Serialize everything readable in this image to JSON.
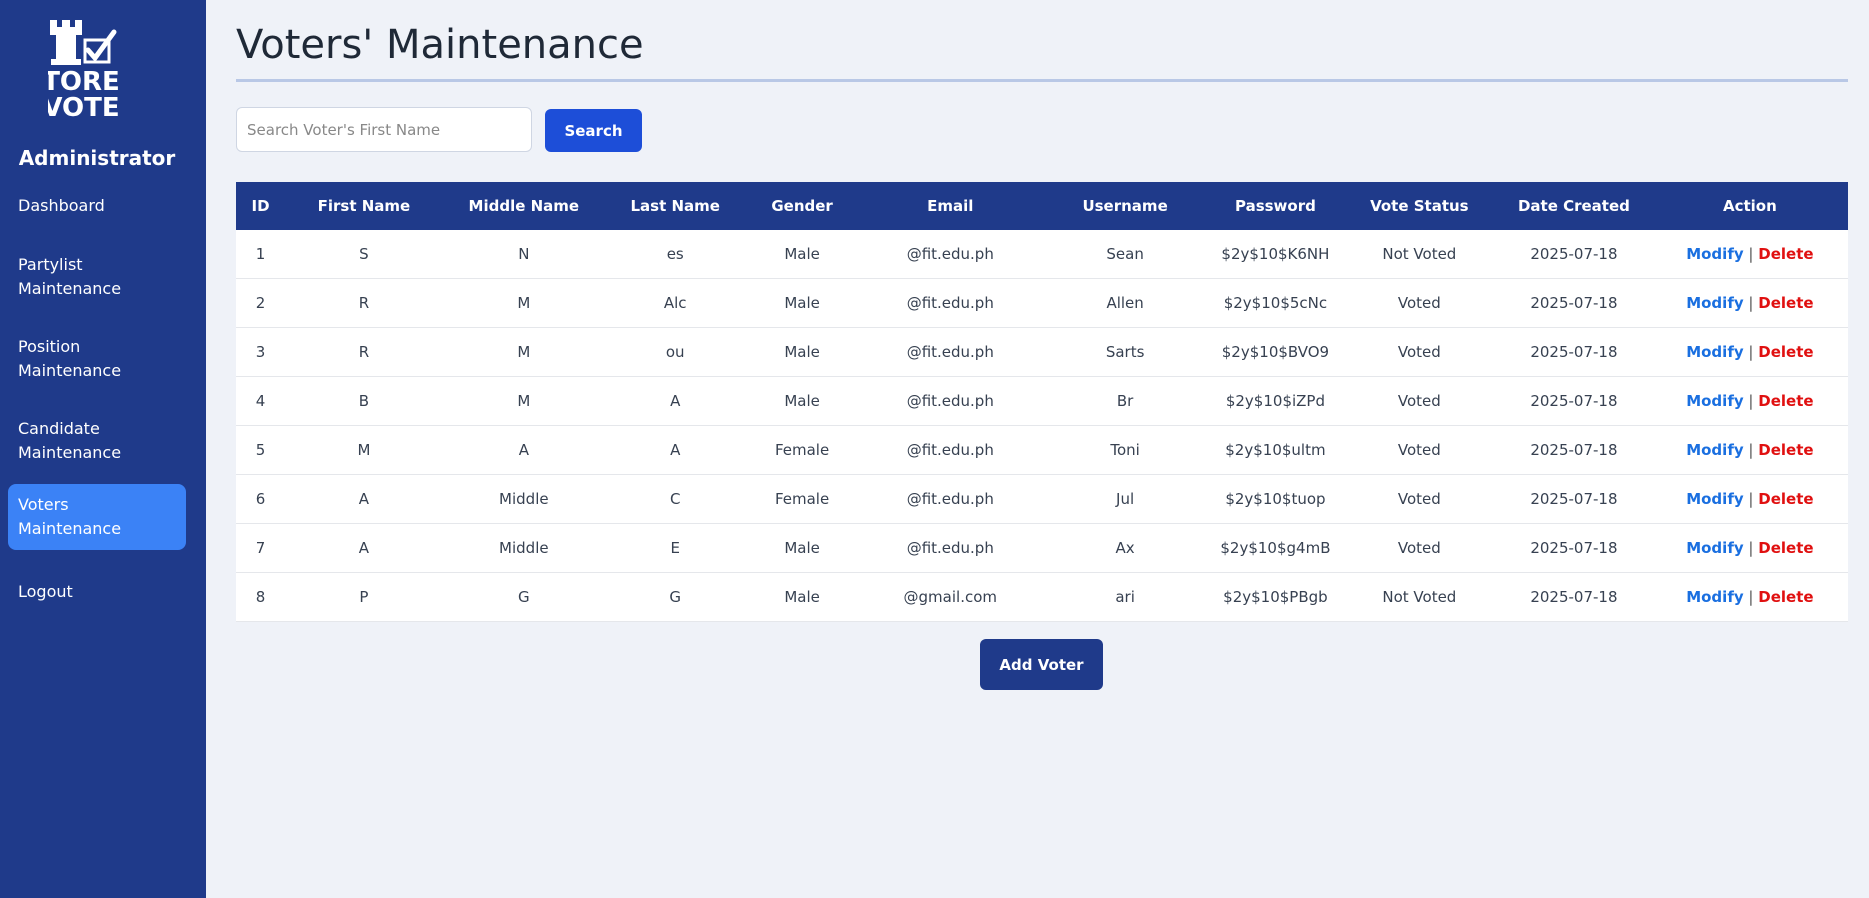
{
  "brand": {
    "logo_text": [
      "TORE",
      "VOTE"
    ],
    "role": "Administrator"
  },
  "nav": [
    {
      "label": "Dashboard",
      "active": false
    },
    {
      "label": "Partylist\nMaintenance",
      "active": false
    },
    {
      "label": "Position\nMaintenance",
      "active": false
    },
    {
      "label": "Candidate\nMaintenance",
      "active": false
    },
    {
      "label": "Voters\nMaintenance",
      "active": true
    },
    {
      "label": "Logout",
      "active": false
    }
  ],
  "page": {
    "title": "Voters' Maintenance"
  },
  "search": {
    "placeholder": "Search Voter's First Name",
    "value": "",
    "button_label": "Search"
  },
  "table": {
    "columns": [
      "ID",
      "First Name",
      "Middle Name",
      "Last Name",
      "Gender",
      "Email",
      "Username",
      "Password",
      "Vote Status",
      "Date Created",
      "Action"
    ],
    "rows": [
      {
        "id": "1",
        "first": "S",
        "middle": "N",
        "last": "es",
        "gender": "Male",
        "email": "@fit.edu.ph",
        "username": "Sean",
        "password": "$2y$10$K6NH",
        "status": "Not Voted",
        "date": "2025-07-18"
      },
      {
        "id": "2",
        "first": "R",
        "middle": "M",
        "last": "Alc",
        "gender": "Male",
        "email": "@fit.edu.ph",
        "username": "Allen",
        "password": "$2y$10$5cNc",
        "status": "Voted",
        "date": "2025-07-18"
      },
      {
        "id": "3",
        "first": "R",
        "middle": "M",
        "last": "ou",
        "gender": "Male",
        "email": "@fit.edu.ph",
        "username": "Sarts",
        "password": "$2y$10$BVO9",
        "status": "Voted",
        "date": "2025-07-18"
      },
      {
        "id": "4",
        "first": "B",
        "middle": "M",
        "last": "A",
        "gender": "Male",
        "email": "@fit.edu.ph",
        "username": "Br",
        "password": "$2y$10$iZPd",
        "status": "Voted",
        "date": "2025-07-18"
      },
      {
        "id": "5",
        "first": "M",
        "middle": "A",
        "last": "A",
        "gender": "Female",
        "email": "@fit.edu.ph",
        "username": "Toni",
        "password": "$2y$10$ultm",
        "status": "Voted",
        "date": "2025-07-18"
      },
      {
        "id": "6",
        "first": "A",
        "middle": "Middle",
        "last": "C",
        "gender": "Female",
        "email": "@fit.edu.ph",
        "username": "Jul",
        "password": "$2y$10$tuop",
        "status": "Voted",
        "date": "2025-07-18"
      },
      {
        "id": "7",
        "first": "A",
        "middle": "Middle",
        "last": "E",
        "gender": "Male",
        "email": "@fit.edu.ph",
        "username": "Ax",
        "password": "$2y$10$g4mB",
        "status": "Voted",
        "date": "2025-07-18"
      },
      {
        "id": "8",
        "first": "P",
        "middle": "G",
        "last": "G",
        "gender": "Male",
        "email": "@gmail.com",
        "username": "ari",
        "password": "$2y$10$PBgb",
        "status": "Not Voted",
        "date": "2025-07-18"
      }
    ],
    "action_modify": "Modify",
    "action_sep": "|",
    "action_delete": "Delete"
  },
  "add_button": "Add Voter",
  "colors": {
    "sidebar": "#1f3a8a",
    "active_nav": "#3b82f6",
    "voted": "#2e8b57",
    "not_voted": "#e04848",
    "modify": "#1a6fe0",
    "delete": "#e01010"
  }
}
